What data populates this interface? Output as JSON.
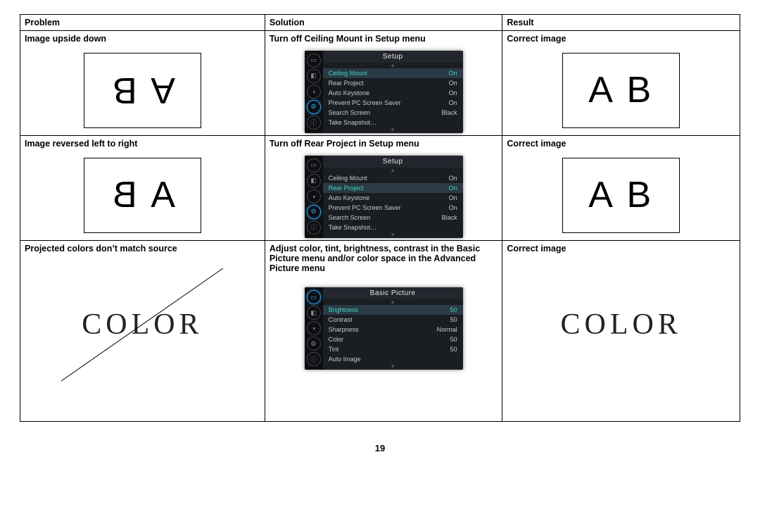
{
  "headers": {
    "problem": "Problem",
    "solution": "Solution",
    "result": "Result"
  },
  "rows": [
    {
      "problem": "Image upside down",
      "solution": "Turn off Ceiling Mount in Setup menu",
      "result": "Correct image",
      "problem_letters": "A B",
      "result_letters": "A B",
      "menu": {
        "title": "Setup",
        "highlight_index": 0,
        "active_side_icon": 3,
        "items": [
          {
            "label": "Ceiling Mount",
            "value": "On"
          },
          {
            "label": "Rear Project",
            "value": "On"
          },
          {
            "label": "Auto Keystone",
            "value": "On"
          },
          {
            "label": "Prevent PC Screen Saver",
            "value": "On"
          },
          {
            "label": "Search Screen",
            "value": "Black"
          },
          {
            "label": "Take Snapshot…",
            "value": ""
          }
        ]
      }
    },
    {
      "problem": "Image reversed left to right",
      "solution": "Turn off Rear Project in Setup menu",
      "result": "Correct image",
      "problem_letters": "A B",
      "result_letters": "A B",
      "menu": {
        "title": "Setup",
        "highlight_index": 1,
        "active_side_icon": 3,
        "items": [
          {
            "label": "Ceiling Mount",
            "value": "On"
          },
          {
            "label": "Rear Project",
            "value": "On"
          },
          {
            "label": "Auto Keystone",
            "value": "On"
          },
          {
            "label": "Prevent PC Screen Saver",
            "value": "On"
          },
          {
            "label": "Search Screen",
            "value": "Black"
          },
          {
            "label": "Take Snapshot…",
            "value": ""
          }
        ]
      }
    },
    {
      "problem": "Projected colors don’t match source",
      "solution": "Adjust color, tint, brightness, contrast in the Basic Picture menu and/or color space in the Advanced Picture menu",
      "result": "Correct image",
      "problem_word": "COLOR",
      "result_word": "COLOR",
      "menu": {
        "title": "Basic Picture",
        "highlight_index": 0,
        "active_side_icon": 0,
        "items": [
          {
            "label": "Brightness",
            "value": "50"
          },
          {
            "label": "Contrast",
            "value": "50"
          },
          {
            "label": "Sharpness",
            "value": "Normal"
          },
          {
            "label": "Color",
            "value": "50"
          },
          {
            "label": "Tint",
            "value": "50"
          },
          {
            "label": "Auto Image",
            "value": ""
          }
        ]
      }
    }
  ],
  "page_number": "19"
}
